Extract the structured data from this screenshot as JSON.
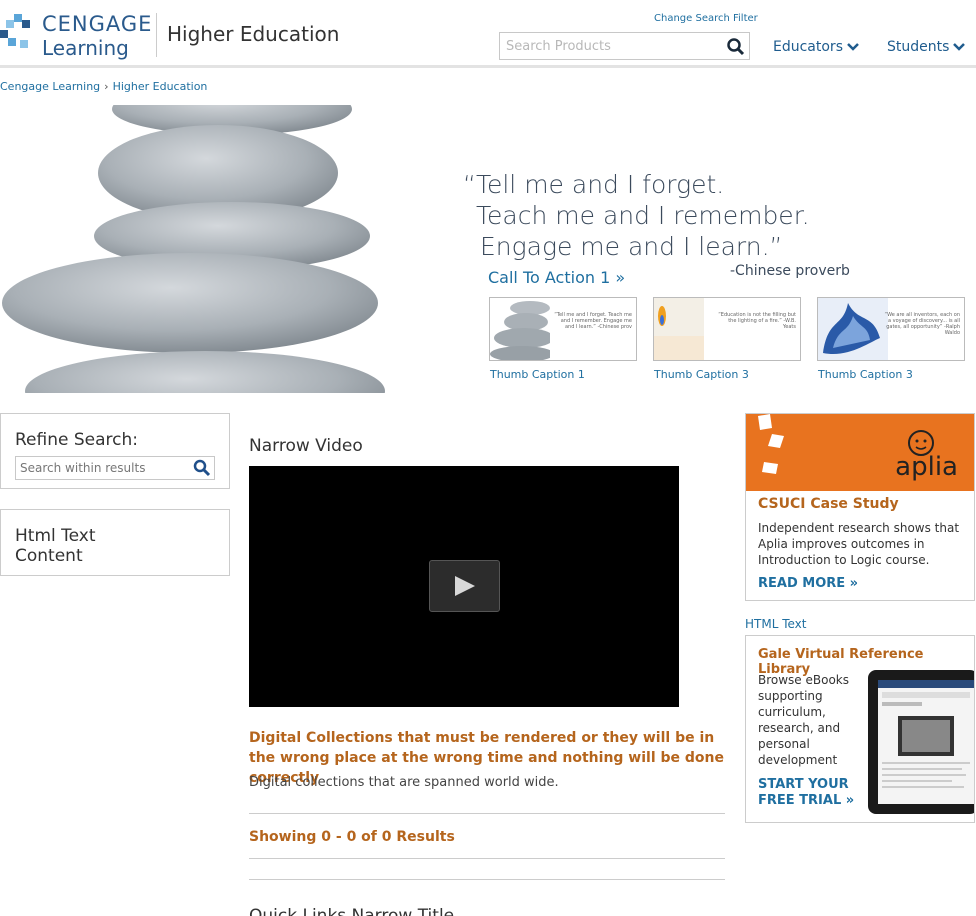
{
  "header": {
    "logo_line1": "CENGAGE",
    "logo_line2": "Learning",
    "site_title": "Higher Education",
    "change_filter": "Change Search Filter",
    "search_placeholder": "Search Products",
    "nav": [
      {
        "label": "Educators"
      },
      {
        "label": "Students"
      }
    ]
  },
  "breadcrumb": {
    "items": [
      "Cengage Learning",
      "Higher Education"
    ]
  },
  "hero": {
    "quote_line1": "“Tell me and I forget.",
    "quote_line2": "Teach me and I remember.",
    "quote_line3": "Engage me and I learn.”",
    "proverb": "-Chinese proverb",
    "cta": "Call To Action 1 »",
    "thumbs": [
      {
        "caption": "Thumb Caption 1",
        "mini_text": "“Tell me and I forget. Teach me and I remember. Engage me and I learn.” -Chinese prov"
      },
      {
        "caption": "Thumb Caption 3",
        "mini_text": "“Education is not the filling but the lighting of a fire.” -W.B. Yeats"
      },
      {
        "caption": "Thumb Caption 3",
        "mini_text": "“We are all inventors, each on a voyage of discovery... is all gates, all opportunity” -Ralph Waldo"
      }
    ]
  },
  "sidebar": {
    "refine_title": "Refine Search:",
    "refine_placeholder": "Search within results",
    "html_box": "Html Text Content"
  },
  "main": {
    "video_title": "Narrow Video",
    "dc_title": "Digital Collections that must be rendered or they will be in the wrong place at the wrong time and nothing will be done correctly",
    "dc_desc": "Digital collections that are spanned world wide.",
    "showing": "Showing 0 - 0 of 0 Results",
    "quick_links_title": "Quick Links Narrow Title"
  },
  "right": {
    "aplia_word": "aplia",
    "aplia_title": "CSUCI Case Study",
    "aplia_text": "Independent research shows that Aplia improves outcomes in Introduction to Logic course.",
    "aplia_more": "READ MORE »",
    "html_text_link": "HTML Text",
    "gale_title": "Gale Virtual Reference Library",
    "gale_text": "Browse eBooks supporting curriculum, research, and personal development",
    "gale_cta": "START YOUR FREE TRIAL »"
  },
  "colors": {
    "brand_blue": "#1f6fa0",
    "accent_orange": "#b5651d",
    "aplia_orange": "#e8731f"
  }
}
